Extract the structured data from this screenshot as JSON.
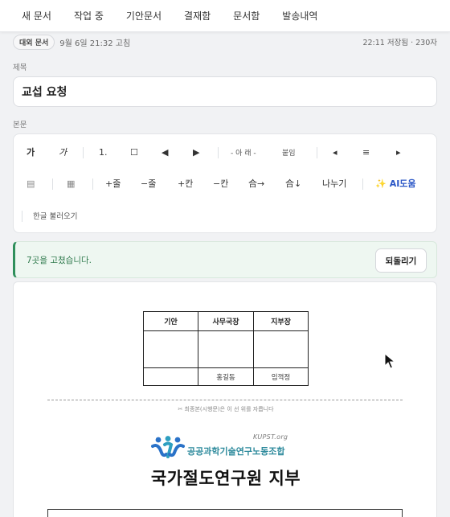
{
  "nav": {
    "tabs": [
      "새 문서",
      "작업 중",
      "기안문서",
      "결재함",
      "문서함",
      "발송내역"
    ]
  },
  "meta": {
    "badge": "대외 문서",
    "edited": "9월 6일 21:32 고침",
    "saved": "22:11 저장됨 · 230자"
  },
  "labels": {
    "title": "제목",
    "body": "본문"
  },
  "title_value": "교섭 요청",
  "toolbar": {
    "bold": "가",
    "italic": "가",
    "ordered_list": "1.",
    "checkbox": "☐",
    "prev": "◀",
    "next": "▶",
    "bottom": "- 아 래 -",
    "attach": "붙임",
    "align_left": "◂",
    "align_center": "≡",
    "align_right": "▸",
    "quote": "▤",
    "table": "▦",
    "add_row": "+줄",
    "del_row": "−줄",
    "add_col": "+칸",
    "del_col": "−칸",
    "merge_right": "合→",
    "merge_down": "合↓",
    "split": "나누기",
    "ai": "AI도움",
    "ai_icon": "✨",
    "import_hwp": "한글 불러오기"
  },
  "notice": {
    "message": "7곳을 고쳤습니다.",
    "revert": "되돌리기"
  },
  "document": {
    "approval": {
      "headers": [
        "기안",
        "사무국장",
        "지부장"
      ],
      "names": [
        "",
        "홍길동",
        "임꺽정"
      ]
    },
    "cut_note": "✂ 최종본(시행문)은 이 선 위를 자릅니다",
    "logo": {
      "sub": "KUPST.org",
      "name": "공공과학기술연구노동조합"
    },
    "title": "국가절도연구원 지부"
  },
  "colors": {
    "accent_green": "#2f8f5b",
    "ai_blue": "#2a56c6",
    "logo_teal": "#2d8a9c"
  }
}
